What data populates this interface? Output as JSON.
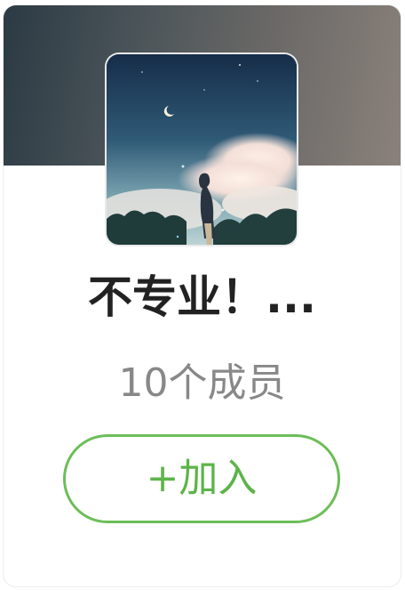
{
  "group": {
    "title": "不专业！...",
    "member_count": "10个成员",
    "cover_alt": "anime-boy-sky-cover"
  },
  "actions": {
    "join_label": "+加入"
  },
  "colors": {
    "accent": "#6cbe58",
    "title": "#222222",
    "subtitle": "#888888"
  }
}
